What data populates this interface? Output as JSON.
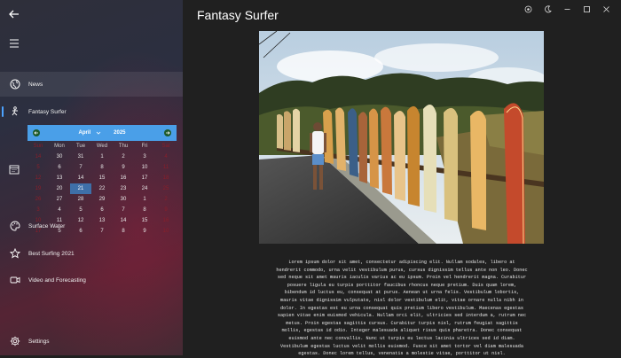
{
  "window": {
    "title": "Fantasy Surfer"
  },
  "nav": {
    "items": [
      {
        "key": "news",
        "label": "News",
        "icon": "globe-icon"
      },
      {
        "key": "fantasy-surfer",
        "label": "Fantasy Surfer",
        "icon": "surfer-icon"
      },
      {
        "key": "surface-water",
        "label": "Surface Water",
        "icon": "palette-icon"
      },
      {
        "key": "best-surfing",
        "label": "Best Surfing 2021",
        "icon": "star-icon"
      },
      {
        "key": "video",
        "label": "Video and Forecasting",
        "icon": "video-icon"
      },
      {
        "key": "settings",
        "label": "Settings",
        "icon": "gear-icon"
      }
    ]
  },
  "calendar": {
    "month": "April",
    "year": "2025",
    "days_of_week": [
      "Sun",
      "Mon",
      "Tue",
      "Wed",
      "Thu",
      "Fri",
      "Sat"
    ],
    "weeks": [
      [
        "14",
        "30",
        "31",
        "1",
        "2",
        "3",
        "4"
      ],
      [
        "5",
        "6",
        "7",
        "8",
        "9",
        "10",
        "11"
      ],
      [
        "12",
        "13",
        "14",
        "15",
        "16",
        "17",
        "18"
      ],
      [
        "19",
        "20",
        "21",
        "22",
        "23",
        "24",
        "25"
      ],
      [
        "26",
        "27",
        "28",
        "29",
        "30",
        "1",
        "2"
      ],
      [
        "3",
        "4",
        "5",
        "6",
        "7",
        "8",
        "9"
      ],
      [
        "10",
        "11",
        "12",
        "13",
        "14",
        "15",
        "16"
      ],
      [
        "17",
        "5",
        "6",
        "7",
        "8",
        "9",
        "10"
      ]
    ],
    "selected_index": [
      3,
      2
    ]
  },
  "content": {
    "body": "Lorem ipsum dolor sit amet, consectetur adipiscing elit. Nullam sodales, libero at hendrerit commodo, urna velit vestibulum purus, cursus dignissim tellus ante non leo. Donec sed neque sit amet mauris iaculis varius ac eu ipsum. Proin vel hendrerit magna. Curabitur posuere ligula eu turpis porttitor faucibus rhoncus neque pretium. Duis quam lorem, bibendum id luctus eu, consequat at purus. Aenean ut urna felis. Vestibulum lobortis, mauris vitae dignissim vulputate, nisl dolor vestibulum elit, vitae ornare nulla nibh in dolor. In egestas est eu urna consequat quis pretium libero vestibulum. Maecenas egestas sapien vitae enim euismod vehicula. Nullam orci elit, ultricies sed interdum a, rutrum nec metus. Proin egestas sagittis cursus. Curabitur turpis nisl, rutrum feugiat sagittis mollis, egestas id odio. Integer malesuada aliquet risus quis pharetra. Donec consequat euismod ante nec convallis. Nunc ut turpis eu lectus lacinia ultrices sed id diam. Vestibulum egestas luctus velit mollis euismod. Fusce sit amet tortor vel diam malesuada egestas. Donec lorem tellus, venenatis a molestie vitae, porttitor ut nisl."
  },
  "colors": {
    "accent": "#4a9fe8",
    "weekend": "#8a1f2a",
    "selected": "#3e6fa8",
    "indicator": "#4da3ff"
  }
}
